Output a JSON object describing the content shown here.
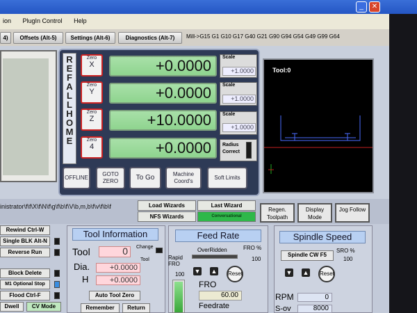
{
  "titlebar": {
    "close_glyph": "✕",
    "icon": "close-icon"
  },
  "menu": {
    "items": [
      "ion",
      "PlugIn Control",
      "Help"
    ]
  },
  "tabs": [
    {
      "label": "4)"
    },
    {
      "label": "Offsets (Alt-5)"
    },
    {
      "label": "Settings (Alt-6)"
    },
    {
      "label": "Diagnostics (Alt-7)"
    }
  ],
  "gcode_line": "Mill->G15  G1 G10 G17 G40 G21 G90 G94 G54 G49 G99 G64",
  "dro": {
    "ref_all_home": "REF ALL HOME",
    "axes": [
      {
        "zero_prefix": "Zero",
        "axis": "X",
        "value": "+0.0000",
        "scale_label": "Scale",
        "scale_value": "+1.0000"
      },
      {
        "zero_prefix": "Zero",
        "axis": "Y",
        "value": "+0.0000",
        "scale_label": "Scale",
        "scale_value": "+1.0000"
      },
      {
        "zero_prefix": "Zero",
        "axis": "Z",
        "value": "+10.0000",
        "scale_label": "Scale",
        "scale_value": "+1.0000"
      },
      {
        "zero_prefix": "Zero",
        "axis": "4",
        "value": "+0.0000",
        "scale_label": "Radius Correct",
        "scale_value": ""
      }
    ],
    "buttons": {
      "offline": "OFFLINE",
      "goto_zero": "GOTO ZERO",
      "to_go": "To Go",
      "machine_coords": "Machine Coord's",
      "soft_limits": "Soft Limits"
    }
  },
  "toolpath": {
    "label": "Tool:0"
  },
  "mid": {
    "path_text": "inistrator\\f\\f\\X\\f\\N\\f\\g\\f\\b\\f\\V\\b,m,b\\f\\v\\f\\b\\f",
    "load_wizards": "Load Wizards",
    "last_wizard": "Last Wizard",
    "nfs_wizards": "NFS Wizards",
    "conversational": "Conversational",
    "regen_toolpath": "Regen. Toolpath",
    "display_mode": "Display Mode",
    "jog_follow": "Jog Follow"
  },
  "left_buttons": {
    "rewind": "Rewind Ctrl-W",
    "single_blk": "Single BLK Alt-N",
    "reverse_run": "Reverse Run",
    "block_delete": "Block Delete",
    "optional_stop": "M1 Optional Stop",
    "flood": "Flood Ctrl-F",
    "dwell": "Dwell",
    "cv_mode": "CV Mode"
  },
  "tool_info": {
    "title": "Tool Information",
    "tool_label": "Tool",
    "tool_value": "0",
    "change_label": "Change",
    "tool_small": "Tool",
    "dia_label": "Dia.",
    "dia_value": "+0.0000",
    "h_label": "H",
    "h_value": "+0.0000",
    "auto_tool_zero": "Auto Tool Zero",
    "remember": "Remember",
    "return": "Return"
  },
  "feed": {
    "title": "Feed Rate",
    "overridden": "OverRidden",
    "fro_pct_label": "FRO %",
    "fro_pct_value": "100",
    "rapid_fro_label": "Rapid FRO",
    "rapid_value": "100",
    "reset": "Reset",
    "fro_label": "FRO",
    "fro_value": "60.00",
    "feedrate_label": "Feedrate"
  },
  "spindle": {
    "title": "Spindle Speed",
    "cw_button": "Spindle CW F5",
    "sro_pct_label": "SRO %",
    "sro_value": "100",
    "reset": "Reset",
    "rpm_label": "RPM",
    "rpm_value": "0",
    "sov_label": "S-ov",
    "sov_value": "8000"
  },
  "colors": {
    "dro_green": "#8fd48f",
    "zero_red": "#cc2222",
    "section_blue": "#b8d0f2"
  }
}
